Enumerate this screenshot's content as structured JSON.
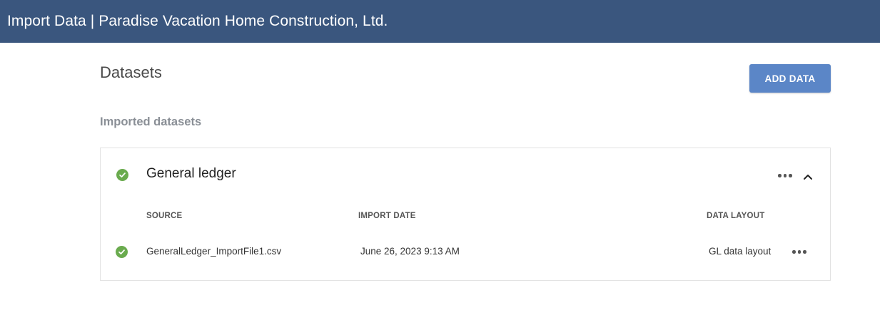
{
  "header": {
    "title": "Import Data | Paradise Vacation Home Construction, Ltd."
  },
  "page": {
    "title": "Datasets",
    "add_button_label": "ADD DATA",
    "section_title": "Imported datasets"
  },
  "dataset": {
    "name": "General ledger",
    "status": "success",
    "columns": {
      "source": "SOURCE",
      "import_date": "IMPORT DATE",
      "data_layout": "DATA LAYOUT"
    },
    "rows": [
      {
        "status": "success",
        "source": "GeneralLedger_ImportFile1.csv",
        "import_date": "June 26, 2023 9:13 AM",
        "data_layout": "GL data layout"
      }
    ]
  },
  "icons": {
    "status": "check-circle-icon",
    "menu": "more-horizontal-icon",
    "collapse": "chevron-up-icon"
  },
  "colors": {
    "header_bg": "#3a567e",
    "accent_button": "#5b86c7",
    "success": "#6aab4e"
  }
}
